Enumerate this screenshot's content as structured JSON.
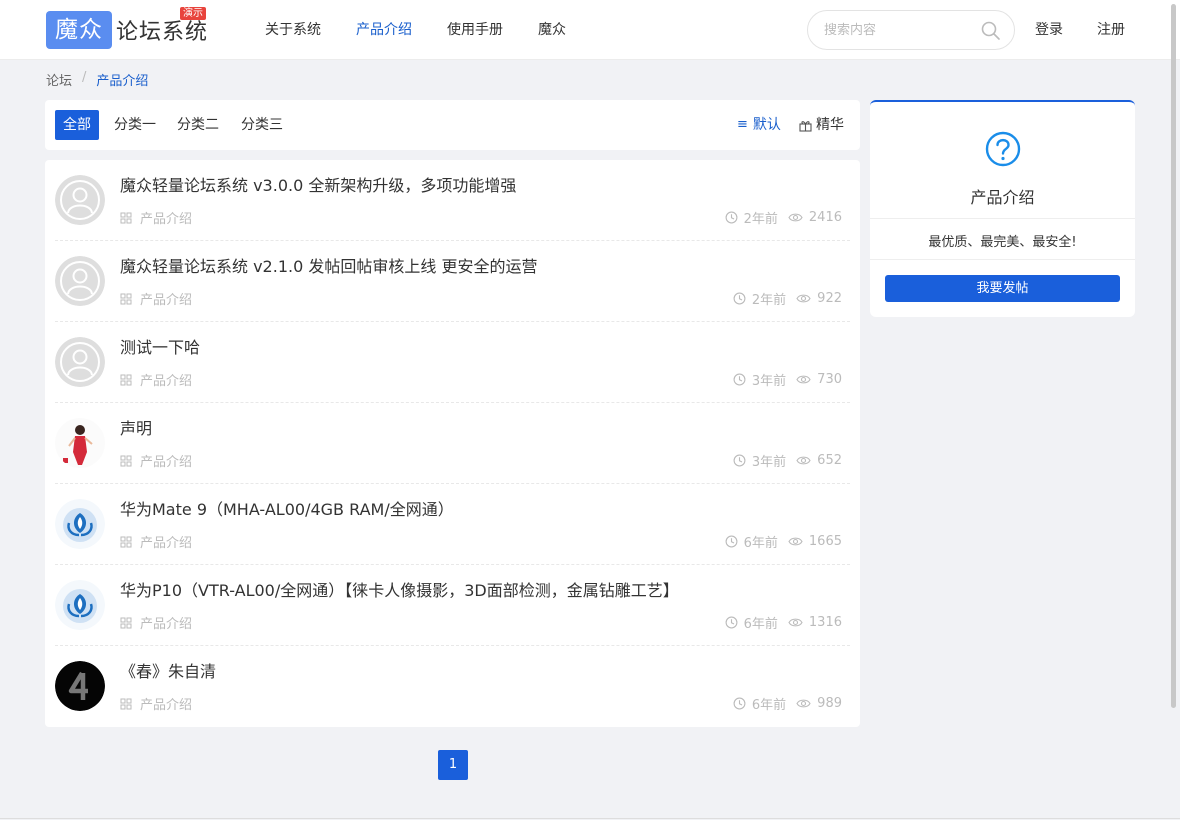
{
  "logo": {
    "box_text": "魔众",
    "text": "论坛系统",
    "badge": "演示"
  },
  "nav": [
    "关于系统",
    "产品介绍",
    "使用手册",
    "魔众"
  ],
  "search": {
    "placeholder": "搜索内容"
  },
  "auth": {
    "login": "登录",
    "register": "注册"
  },
  "breadcrumb": {
    "home": "论坛",
    "sep": "/",
    "current": "产品介绍"
  },
  "tabs": [
    "全部",
    "分类一",
    "分类二",
    "分类三"
  ],
  "sort": {
    "default_icon": "≡",
    "default": "默认",
    "featured": "精华"
  },
  "posts": [
    {
      "title": "魔众轻量论坛系统 v3.0.0 全新架构升级，多项功能增强",
      "category": "产品介绍",
      "time": "2年前",
      "views": "2416",
      "avatar": "default"
    },
    {
      "title": "魔众轻量论坛系统 v2.1.0 发帖回帖审核上线 更安全的运营",
      "category": "产品介绍",
      "time": "2年前",
      "views": "922",
      "avatar": "default"
    },
    {
      "title": "测试一下哈",
      "category": "产品介绍",
      "time": "3年前",
      "views": "730",
      "avatar": "default"
    },
    {
      "title": "声明",
      "category": "产品介绍",
      "time": "3年前",
      "views": "652",
      "avatar": "woman"
    },
    {
      "title": "华为Mate 9（MHA-AL00/4GB RAM/全网通）",
      "category": "产品介绍",
      "time": "6年前",
      "views": "1665",
      "avatar": "huawei"
    },
    {
      "title": "华为P10（VTR-AL00/全网通）【徕卡人像摄影，3D面部检测，金属钻雕工艺】",
      "category": "产品介绍",
      "time": "6年前",
      "views": "1316",
      "avatar": "huawei"
    },
    {
      "title": "《春》朱自清",
      "category": "产品介绍",
      "time": "6年前",
      "views": "989",
      "avatar": "four"
    }
  ],
  "pagination": {
    "current": "1"
  },
  "sidebar": {
    "title": "产品介绍",
    "slogan": "最优质、最完美、最安全!",
    "button": "我要发帖"
  },
  "colors": {
    "accent": "#1a5fdb",
    "logo": "#5a8df0",
    "badge": "#e8443d"
  }
}
